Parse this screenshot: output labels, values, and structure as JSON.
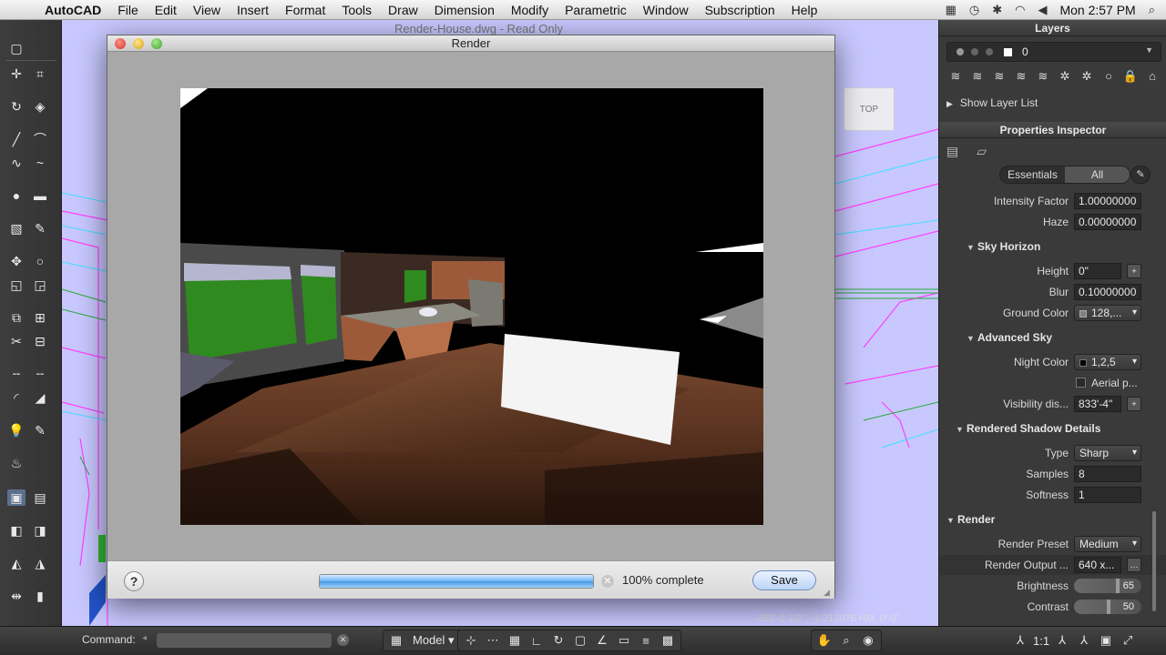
{
  "menubar": {
    "app_name": "AutoCAD",
    "items": [
      "File",
      "Edit",
      "View",
      "Insert",
      "Format",
      "Tools",
      "Draw",
      "Dimension",
      "Modify",
      "Parametric",
      "Window",
      "Subscription",
      "Help"
    ],
    "clock": "Mon 2:57 PM"
  },
  "background_window_title": "Render-House.dwg - Read Only",
  "viewcube_label": "TOP",
  "coordinates": "-355'-2 1/2\", -1.21707E+03, 0'-0\"",
  "render_dialog": {
    "title": "Render",
    "progress_percent": 100,
    "progress_text": "100% complete",
    "save_label": "Save",
    "help_label": "?"
  },
  "layers": {
    "title": "Layers",
    "current_layer": "0",
    "show_layer_list": "Show Layer List"
  },
  "properties": {
    "title": "Properties Inspector",
    "tab_essentials": "Essentials",
    "tab_all": "All",
    "intensity_factor": {
      "label": "Intensity Factor",
      "value": "1.00000000"
    },
    "haze": {
      "label": "Haze",
      "value": "0.00000000"
    },
    "sky_horizon": "Sky Horizon",
    "height": {
      "label": "Height",
      "value": "0\""
    },
    "blur": {
      "label": "Blur",
      "value": "0.10000000"
    },
    "ground_color": {
      "label": "Ground Color",
      "value": "128,..."
    },
    "advanced_sky": "Advanced Sky",
    "night_color": {
      "label": "Night Color",
      "value": "1,2,5"
    },
    "aerial": "Aerial p...",
    "visibility": {
      "label": "Visibility dis...",
      "value": "833'-4\""
    },
    "shadow_section": "Rendered Shadow Details",
    "type": {
      "label": "Type",
      "value": "Sharp"
    },
    "samples": {
      "label": "Samples",
      "value": "8"
    },
    "softness": {
      "label": "Softness",
      "value": "1"
    },
    "render_section": "Render",
    "render_preset": {
      "label": "Render Preset",
      "value": "Medium"
    },
    "render_output": {
      "label": "Render Output ...",
      "value": "640 x..."
    },
    "brightness": {
      "label": "Brightness",
      "value": "65"
    },
    "contrast": {
      "label": "Contrast",
      "value": "50"
    }
  },
  "statusbar": {
    "command_label": "Command:",
    "model_label": "Model",
    "scale": "1:1"
  },
  "colors": {
    "drawing_bg": "#c8c8ff",
    "panel_bg": "#3a3a3a",
    "accent_progress": "#4796e2"
  }
}
